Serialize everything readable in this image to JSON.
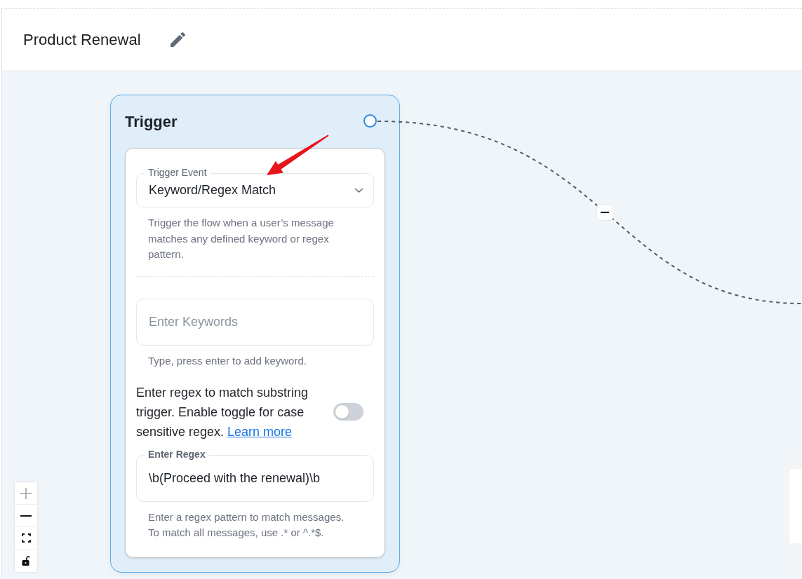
{
  "flow": {
    "title": "Product Renewal"
  },
  "trigger_node": {
    "title": "Trigger",
    "trigger_event": {
      "label": "Trigger Event",
      "value": "Keyword/Regex Match",
      "description": "Trigger the flow when a user’s message matches any defined keyword or regex pattern."
    },
    "keywords": {
      "placeholder": "Enter Keywords",
      "hint": "Type, press enter to add keyword."
    },
    "case_sensitive": {
      "text": "Enter regex to match substring trigger. Enable toggle for case sensitive regex.",
      "link": "Learn more",
      "on": false
    },
    "regex": {
      "label": "Enter Regex",
      "value": "\\b(Proceed with the renewal)\\b",
      "hint": "Enter a regex pattern to match messages. To match all messages, use .* or ^.*$."
    }
  },
  "zoom_controls": [
    {
      "kind": "zoom_in",
      "disabled": true
    },
    {
      "kind": "zoom_out",
      "disabled": false
    },
    {
      "kind": "fit",
      "disabled": false
    },
    {
      "kind": "lock",
      "disabled": false
    }
  ]
}
